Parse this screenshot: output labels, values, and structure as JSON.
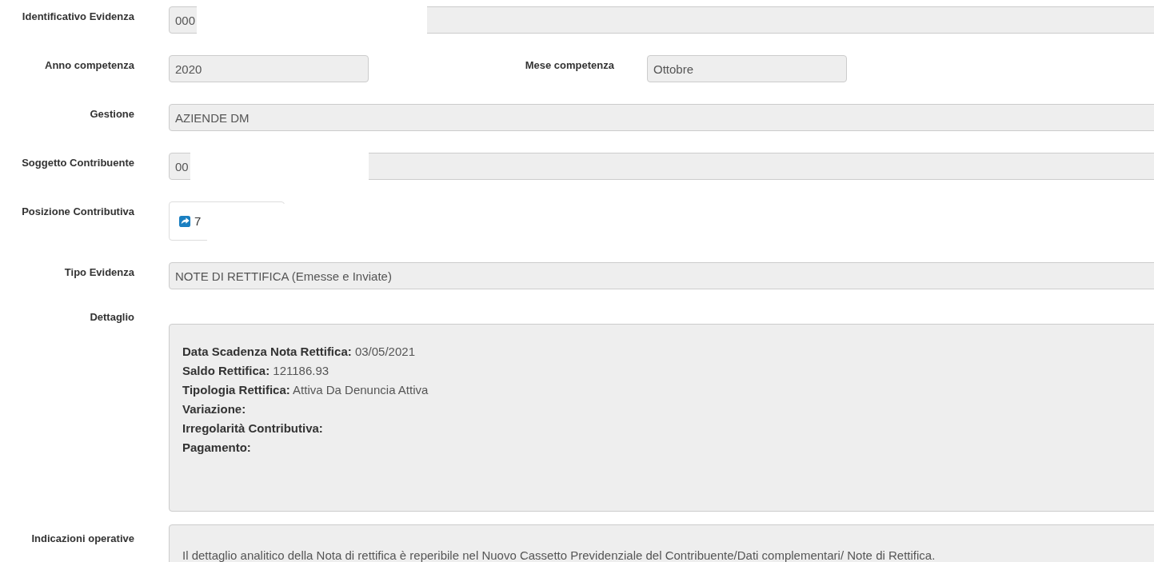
{
  "fields": [
    {
      "kind": "input",
      "label": "Identificativo Evidenza",
      "value": "000",
      "masked": true
    },
    {
      "kind": "pair",
      "label": "Anno competenza",
      "value": "2020",
      "second_label": "Mese competenza",
      "second_value": "Ottobre"
    },
    {
      "kind": "input",
      "label": "Gestione",
      "value": "AZIENDE DM",
      "masked": false
    },
    {
      "kind": "input",
      "label": "Soggetto Contribuente",
      "value": "00",
      "masked": true
    },
    {
      "kind": "link",
      "label": "Posizione Contributiva",
      "value": "7",
      "masked": true
    },
    {
      "kind": "input",
      "label": "Tipo Evidenza",
      "value": "NOTE DI RETTIFICA (Emesse e Inviate)",
      "masked": false
    },
    {
      "kind": "detail",
      "label": "Dettaglio",
      "lines": [
        "**Data Scadenza Nota Rettifica:** 03/05/2021",
        "**Saldo Rettifica:** 121186.93",
        "**Tipologia Rettifica:** Attiva Da Denuncia Attiva",
        "**Variazione:**",
        "**Irregolarità Contributiva:**",
        "**Pagamento:**"
      ]
    },
    {
      "kind": "note",
      "label": "Indicazioni operative",
      "text": "Il dettaglio analitico della Nota di rettifica è reperibile nel Nuovo Cassetto Previdenziale del Contribuente/Dati complementari/ Note di Rettifica."
    }
  ]
}
